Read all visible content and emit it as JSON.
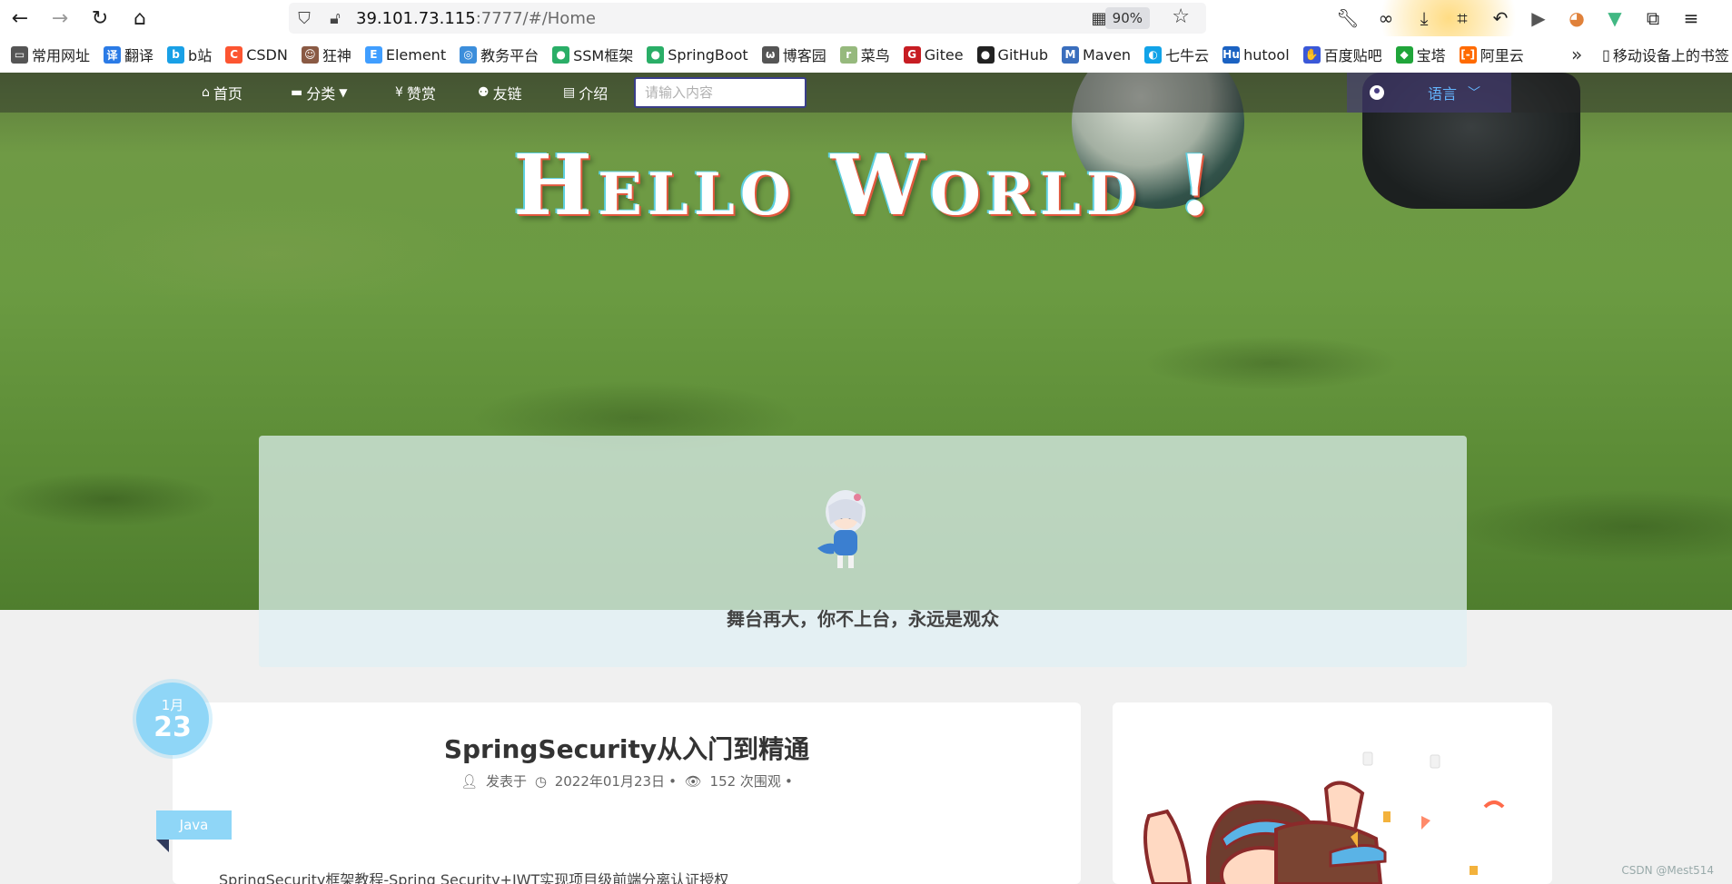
{
  "browser": {
    "address": {
      "host": "39.101.73.115",
      "path": ":7777/#/Home"
    },
    "zoom": "90%"
  },
  "bookmarks": [
    {
      "label": "常用网址",
      "icon": "folder-icon",
      "color": "#555555",
      "glyph": "▭"
    },
    {
      "label": "翻译",
      "icon": "translate-icon",
      "color": "#2b7be6",
      "glyph": "译"
    },
    {
      "label": "b站",
      "icon": "bilibili-icon",
      "color": "#19a0e6",
      "glyph": "b"
    },
    {
      "label": "CSDN",
      "icon": "csdn-icon",
      "color": "#fc5531",
      "glyph": "C"
    },
    {
      "label": "狂神",
      "icon": "avatar-icon",
      "color": "#8a5a44",
      "glyph": "☺"
    },
    {
      "label": "Element",
      "icon": "element-icon",
      "color": "#409eff",
      "glyph": "E"
    },
    {
      "label": "教务平台",
      "icon": "edu-icon",
      "color": "#3c8edb",
      "glyph": "◎"
    },
    {
      "label": "SSM框架",
      "icon": "wechat-icon",
      "color": "#2aae67",
      "glyph": "●"
    },
    {
      "label": "SpringBoot",
      "icon": "wechat-icon",
      "color": "#2aae67",
      "glyph": "●"
    },
    {
      "label": "博客园",
      "icon": "cnblogs-icon",
      "color": "#555555",
      "glyph": "ω"
    },
    {
      "label": "菜鸟",
      "icon": "runoob-icon",
      "color": "#96b97d",
      "glyph": "r"
    },
    {
      "label": "Gitee",
      "icon": "gitee-icon",
      "color": "#c71d23",
      "glyph": "G"
    },
    {
      "label": "GitHub",
      "icon": "github-icon",
      "color": "#222222",
      "glyph": "●"
    },
    {
      "label": "Maven",
      "icon": "maven-icon",
      "color": "#3a6ebd",
      "glyph": "M"
    },
    {
      "label": "七牛云",
      "icon": "qiniu-icon",
      "color": "#12a3e8",
      "glyph": "◐"
    },
    {
      "label": "hutool",
      "icon": "hutool-icon",
      "color": "#1b62c2",
      "glyph": "Hu"
    },
    {
      "label": "百度贴吧",
      "icon": "tieba-icon",
      "color": "#3a58d8",
      "glyph": "✋"
    },
    {
      "label": "宝塔",
      "icon": "baota-icon",
      "color": "#20a53a",
      "glyph": "◆"
    },
    {
      "label": "阿里云",
      "icon": "aliyun-icon",
      "color": "#ff6a00",
      "glyph": "[-]"
    }
  ],
  "bookmark_mobile": "移动设备上的书签",
  "nav": {
    "items": [
      {
        "label": "首页",
        "icon": "home-icon",
        "glyph": "⌂"
      },
      {
        "label": "分类",
        "icon": "category-icon",
        "glyph": "▬"
      },
      {
        "label": "赞赏",
        "icon": "yen-icon",
        "glyph": "¥"
      },
      {
        "label": "友链",
        "icon": "users-icon",
        "glyph": "⚉"
      },
      {
        "label": "介绍",
        "icon": "newspaper-icon",
        "glyph": "▤"
      }
    ],
    "search_placeholder": "请输入内容",
    "language_label": "语言"
  },
  "hero": {
    "title": "Hello World !",
    "motto": "舞台再大，你不上台，永远是观众"
  },
  "post": {
    "month": "1月",
    "day": "23",
    "title": "SpringSecurity从入门到精通",
    "published_prefix": "发表于",
    "date": "2022年01月23日",
    "views": "152 次围观",
    "category": "Java",
    "excerpt": "SpringSecurity框架教程-Spring Security+JWT实现项目级前端分离认证授权"
  },
  "watermark": "CSDN @Mest514"
}
